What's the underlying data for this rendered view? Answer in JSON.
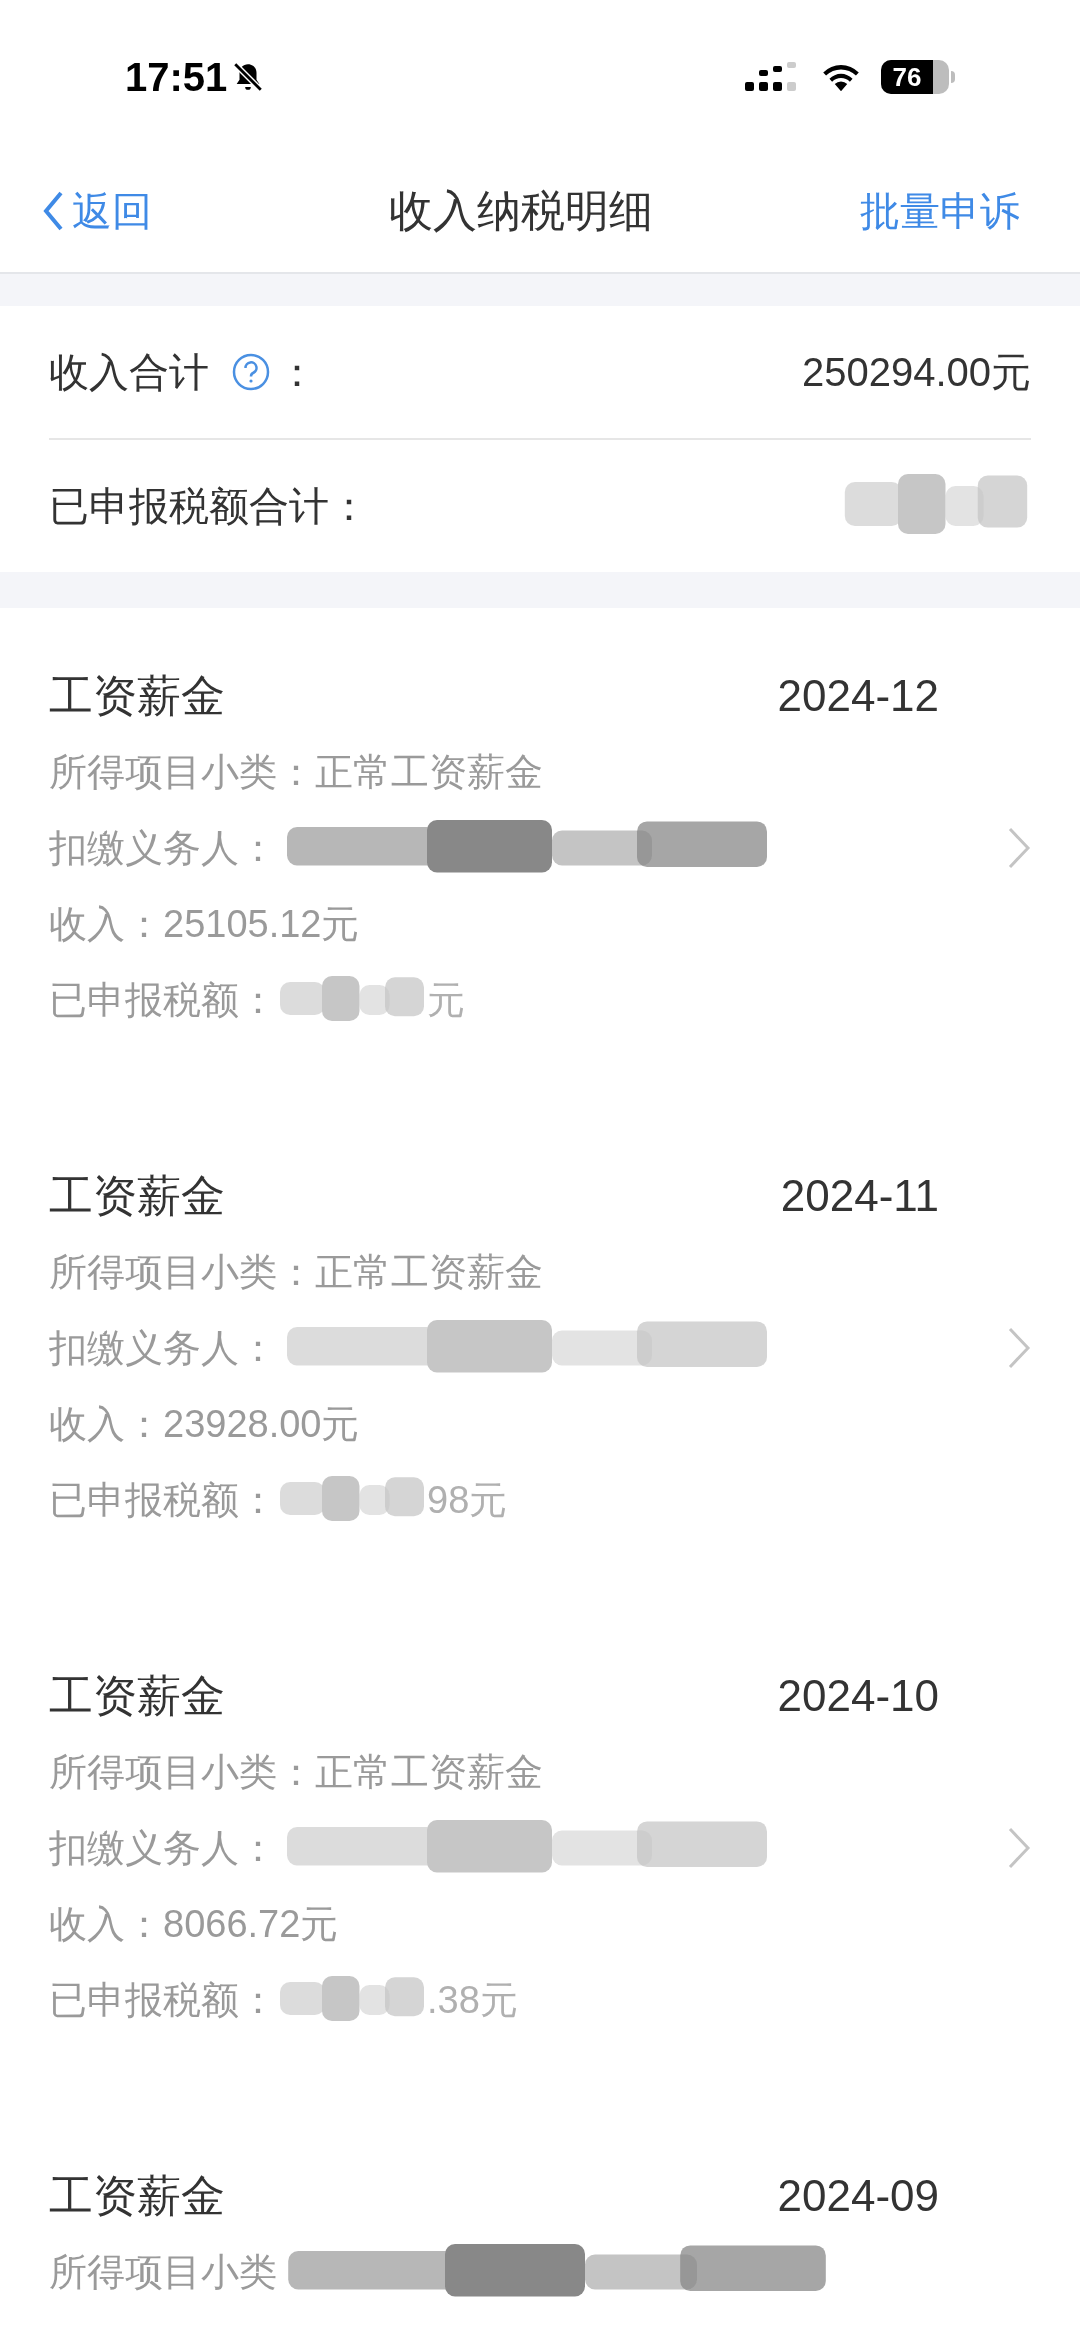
{
  "status_bar": {
    "time": "17:51",
    "battery": "76"
  },
  "nav": {
    "back": "返回",
    "title": "收入纳税明细",
    "action": "批量申诉"
  },
  "summary": {
    "income_label": "收入合计",
    "income_colon": "：",
    "income_value": "250294.00元",
    "tax_label": "已申报税额合计："
  },
  "records": [
    {
      "title": "工资薪金",
      "period": "2024-12",
      "subcategory": "所得项目小类：正常工资薪金",
      "payer_label": "扣缴义务人：",
      "income": "收入：25105.12元",
      "tax_label": "已申报税额：",
      "tax_visible": "元"
    },
    {
      "title": "工资薪金",
      "period": "2024-11",
      "subcategory": "所得项目小类：正常工资薪金",
      "payer_label": "扣缴义务人：",
      "income": "收入：23928.00元",
      "tax_label": "已申报税额：",
      "tax_visible": "98元"
    },
    {
      "title": "工资薪金",
      "period": "2024-10",
      "subcategory": "所得项目小类：正常工资薪金",
      "payer_label": "扣缴义务人：",
      "income": "收入：8066.72元",
      "tax_label": "已申报税额：",
      "tax_visible": ".38元"
    },
    {
      "title": "工资薪金",
      "period": "2024-09",
      "subcategory": "所得项目小类"
    }
  ]
}
